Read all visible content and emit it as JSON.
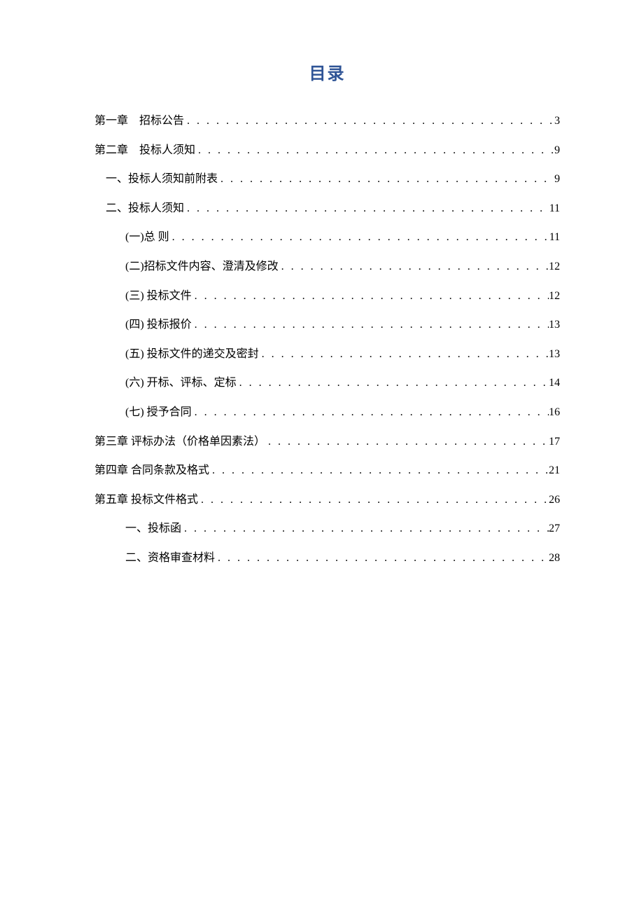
{
  "title": "目录",
  "entries": [
    {
      "level": 0,
      "label": "第一章　招标公告",
      "page": "3"
    },
    {
      "level": 0,
      "label": "第二章　投标人须知",
      "page": "9"
    },
    {
      "level": 1,
      "label": "一、投标人须知前附表",
      "page": "9"
    },
    {
      "level": 1,
      "label": "二、投标人须知",
      "page": "11"
    },
    {
      "level": 2,
      "label": "(一)总 则",
      "page": "11"
    },
    {
      "level": 2,
      "label": "(二)招标文件内容、澄清及修改",
      "page": "12"
    },
    {
      "level": 2,
      "label": "(三) 投标文件",
      "page": "12"
    },
    {
      "level": 2,
      "label": "(四) 投标报价",
      "page": "13"
    },
    {
      "level": 2,
      "label": "(五) 投标文件的递交及密封",
      "page": "13"
    },
    {
      "level": 2,
      "label": "(六) 开标、评标、定标",
      "page": "14"
    },
    {
      "level": 2,
      "label": "(七) 授予合同",
      "page": "16"
    },
    {
      "level": 0,
      "label": "第三章 评标办法（价格单因素法）",
      "page": "17"
    },
    {
      "level": 0,
      "label": "第四章 合同条款及格式",
      "page": "21"
    },
    {
      "level": 0,
      "label": "第五章 投标文件格式",
      "page": "26"
    },
    {
      "level": 2,
      "label": "一、投标函",
      "page": "27"
    },
    {
      "level": 2,
      "label": "二、资格审查材料",
      "page": "28"
    }
  ]
}
